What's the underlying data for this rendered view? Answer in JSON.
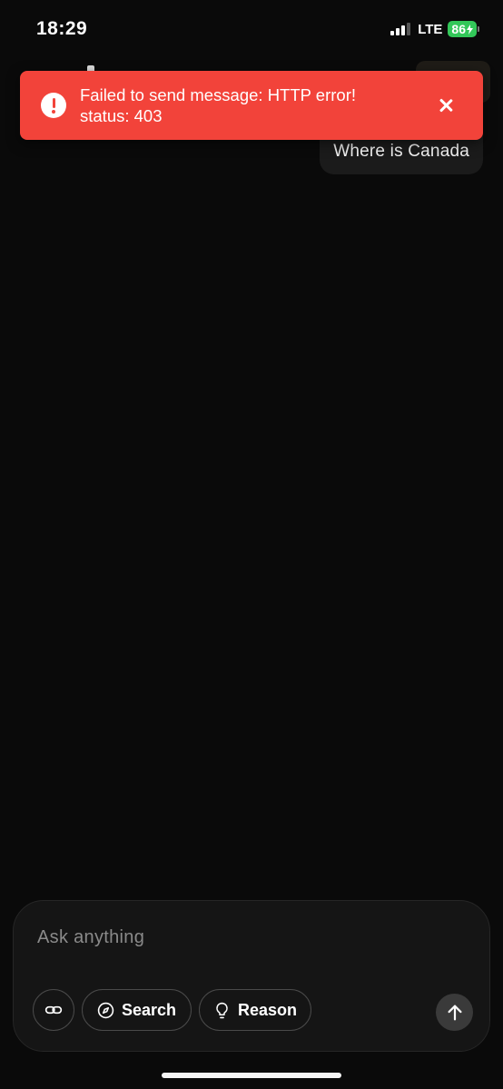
{
  "status_bar": {
    "time": "18:29",
    "network": "LTE",
    "battery_level": "86",
    "battery_color": "#33c759"
  },
  "toast": {
    "message": "Failed to send message: HTTP error! status: 403",
    "icon": "error-icon",
    "close_icon": "close-icon",
    "background_color": "#f2433a"
  },
  "chat": {
    "messages": [
      {
        "role": "user",
        "text": "Where is Canada"
      }
    ]
  },
  "composer": {
    "placeholder": "Ask anything",
    "value": "",
    "tools": {
      "link_icon": "link-icon",
      "search_label": "Search",
      "search_icon": "compass-icon",
      "reason_label": "Reason",
      "reason_icon": "lightbulb-icon"
    },
    "send_icon": "arrow-up-icon"
  }
}
